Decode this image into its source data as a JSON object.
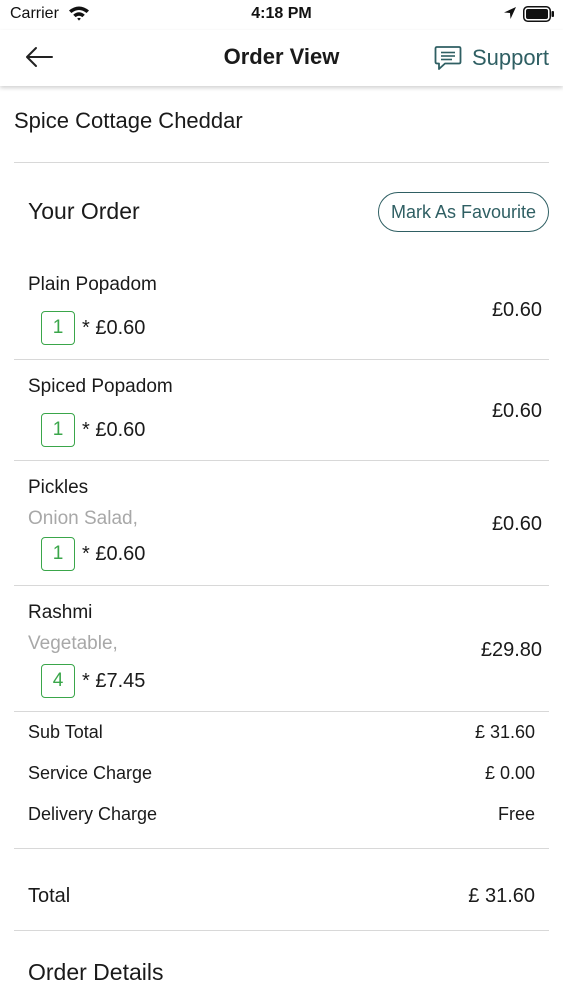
{
  "status_bar": {
    "carrier": "Carrier",
    "time": "4:18 PM"
  },
  "nav": {
    "title": "Order View",
    "support_label": "Support"
  },
  "restaurant": {
    "name": "Spice Cottage Cheddar"
  },
  "order": {
    "title": "Your Order",
    "favourite_label": "Mark As Favourite",
    "items": [
      {
        "name": "Plain Popadom",
        "note": "",
        "qty": "1",
        "unit_price": "* £0.60",
        "total": "£0.60"
      },
      {
        "name": "Spiced Popadom",
        "note": "",
        "qty": "1",
        "unit_price": "* £0.60",
        "total": "£0.60"
      },
      {
        "name": "Pickles",
        "note": "Onion Salad,",
        "qty": "1",
        "unit_price": "* £0.60",
        "total": "£0.60"
      },
      {
        "name": "Rashmi",
        "note": "Vegetable,",
        "qty": "4",
        "unit_price": "* £7.45",
        "total": "£29.80"
      }
    ]
  },
  "summary": {
    "sub_total_label": "Sub Total",
    "sub_total_value": "£ 31.60",
    "service_label": "Service Charge",
    "service_value": "£ 0.00",
    "delivery_label": "Delivery Charge",
    "delivery_value": "Free",
    "total_label": "Total",
    "total_value": "£ 31.60"
  },
  "details": {
    "title": "Order Details"
  },
  "colors": {
    "accent": "#2f5f63",
    "qty_green": "#3aa64a",
    "muted_text": "#a8a8a8"
  }
}
